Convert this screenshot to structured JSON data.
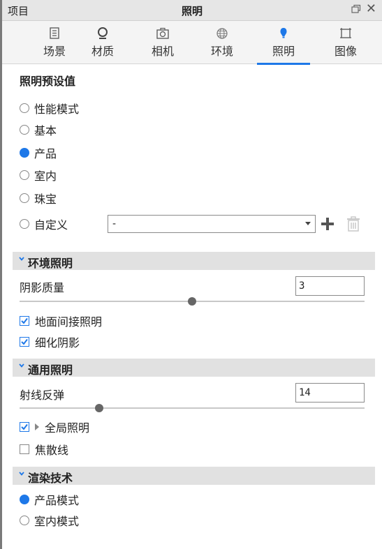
{
  "titlebar": {
    "left_title": "项目",
    "center_title": "照明"
  },
  "tabs": [
    {
      "label": "场景",
      "icon": "list-icon"
    },
    {
      "label": "材质",
      "icon": "material-icon"
    },
    {
      "label": "相机",
      "icon": "camera-icon"
    },
    {
      "label": "环境",
      "icon": "globe-icon"
    },
    {
      "label": "照明",
      "icon": "bulb-icon",
      "active": true
    },
    {
      "label": "图像",
      "icon": "image-frame-icon"
    }
  ],
  "presets": {
    "title": "照明预设值",
    "options": [
      "性能模式",
      "基本",
      "产品",
      "室内",
      "珠宝",
      "自定义"
    ],
    "selected": "产品",
    "custom_select_value": "-"
  },
  "environment_lighting": {
    "header": "环境照明",
    "shadow_quality_label": "阴影质量",
    "shadow_quality_value": "3",
    "shadow_quality_slider": 0.5,
    "ground_indirect_label": "地面间接照明",
    "ground_indirect_checked": true,
    "refine_shadows_label": "细化阴影",
    "refine_shadows_checked": true
  },
  "general_lighting": {
    "header": "通用照明",
    "ray_bounces_label": "射线反弹",
    "ray_bounces_value": "14",
    "ray_bounces_slider": 0.23,
    "global_illumination_label": "全局照明",
    "global_illumination_checked": true,
    "caustics_label": "焦散线",
    "caustics_checked": false
  },
  "render_technique": {
    "header": "渲染技术",
    "options": [
      "产品模式",
      "室内模式"
    ],
    "selected": "产品模式"
  },
  "colors": {
    "accent": "#1e78e8",
    "header_bg": "#e1e1e1",
    "tab_bg": "#f4f4f4"
  }
}
